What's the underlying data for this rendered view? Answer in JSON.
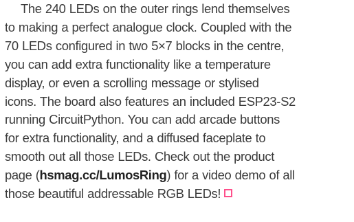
{
  "article": {
    "lines": [
      "The 240 LEDs on the outer rings lend themselves",
      "to making a perfect analogue clock. Coupled with the",
      "70 LEDs configured in two 5×7 blocks in the centre,",
      "you can add extra functionality like a temperature",
      "display, or even a scrolling message or stylised",
      "icons. The board also features an included ESP23-S2",
      "running CircuitPython. You can add arcade buttons",
      "for extra functionality, and a diffused faceplate to",
      "smooth out all those LEDs. Check out the product"
    ],
    "line10_before": "page (",
    "link": "hsmag.cc/LumosRing",
    "line10_after": ") for a video demo of all",
    "line11": "those beautiful addressable RGB LEDs!",
    "end_mark_color": "#ff4f8b",
    "text_color": "#3a3a3a"
  }
}
